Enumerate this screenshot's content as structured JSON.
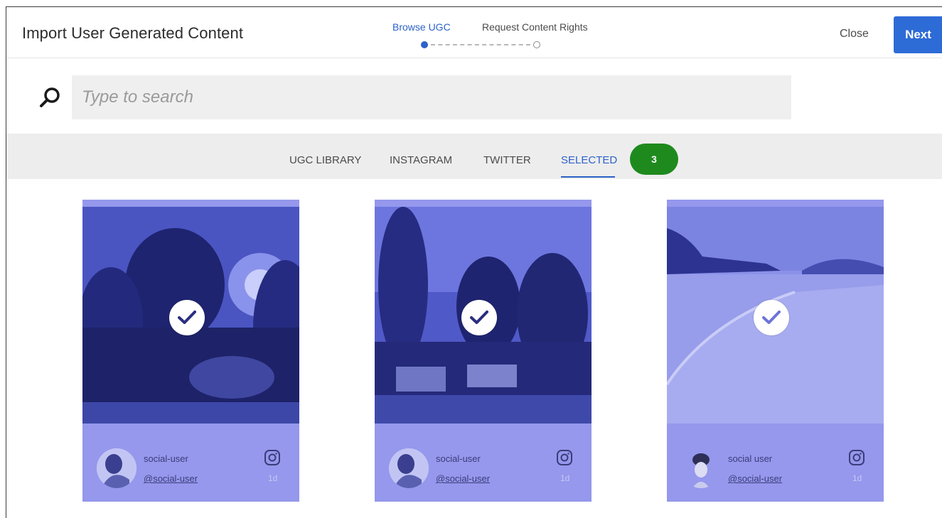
{
  "header": {
    "title": "Import User Generated Content",
    "steps": [
      {
        "label": "Browse UGC",
        "active": true
      },
      {
        "label": "Request Content Rights",
        "active": false
      }
    ],
    "close_label": "Close",
    "next_label": "Next"
  },
  "search": {
    "placeholder": "Type to search",
    "value": "",
    "icon": "search-icon"
  },
  "tabs": {
    "items": [
      {
        "label": "UGC LIBRARY"
      },
      {
        "label": "INSTAGRAM"
      },
      {
        "label": "TWITTER"
      },
      {
        "label": "SELECTED"
      }
    ],
    "active": "SELECTED",
    "selected_count": "3"
  },
  "cards": [
    {
      "username": "social-user",
      "handle": "@social-user",
      "age": "1d",
      "source_icon": "instagram-icon",
      "selected": true
    },
    {
      "username": "social-user",
      "handle": "@social-user",
      "age": "1d",
      "source_icon": "instagram-icon",
      "selected": true
    },
    {
      "username": "social user",
      "handle": "@social-user",
      "age": "1d",
      "source_icon": "instagram-icon",
      "selected": true
    }
  ],
  "colors": {
    "accent": "#2d62c8",
    "next_button": "#2d6bd6",
    "badge": "#1e8a1e",
    "selection_overlay": "#9598ec"
  }
}
